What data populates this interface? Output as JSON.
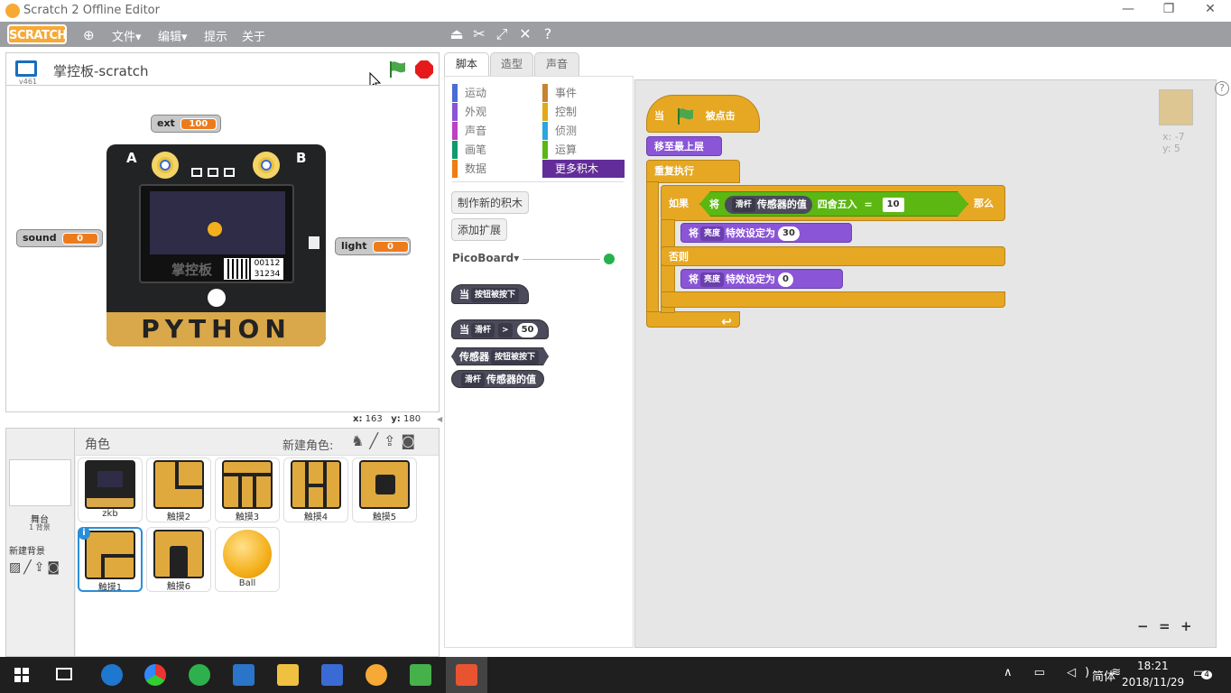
{
  "window": {
    "title": "Scratch 2 Offline Editor",
    "minimize": "—",
    "restore": "❐",
    "close": "✕"
  },
  "menu": {
    "logo": "SCRATCH",
    "file": "文件▾",
    "edit": "编辑▾",
    "tips": "提示",
    "about": "关于",
    "globe_icon": "globe-icon",
    "tools": [
      "stamp-icon",
      "cut-icon",
      "grow-icon",
      "shrink-icon",
      "help-icon"
    ]
  },
  "stage": {
    "title": "掌控板-scratch",
    "version": "v461",
    "coords": {
      "x_label": "x:",
      "x": "163",
      "y_label": "y:",
      "y": "180"
    },
    "monitors": {
      "ext": {
        "label": "ext",
        "value": "100"
      },
      "sound": {
        "label": "sound",
        "value": "0"
      },
      "light": {
        "label": "light",
        "value": "0"
      }
    },
    "board": {
      "a": "A",
      "b": "B",
      "logo_text": "掌控板",
      "code1": "00112",
      "code2": "31234",
      "python": "PYTHON"
    }
  },
  "sprites": {
    "header": "角色",
    "new_sprite": "新建角色:",
    "stage_label": "舞台",
    "stage_count": "1 背景",
    "new_backdrop": "新建背景",
    "items": [
      {
        "name": "zkb"
      },
      {
        "name": "触摸2"
      },
      {
        "name": "触摸3"
      },
      {
        "name": "触摸4"
      },
      {
        "name": "触摸5"
      },
      {
        "name": "触摸1"
      },
      {
        "name": "触摸6"
      },
      {
        "name": "Ball"
      }
    ]
  },
  "tabs": {
    "scripts": "脚本",
    "costumes": "造型",
    "sounds": "声音"
  },
  "palette": {
    "categories": [
      {
        "label": "运动",
        "color": "#4a6cd4"
      },
      {
        "label": "事件",
        "color": "#c88330"
      },
      {
        "label": "外观",
        "color": "#8a55d7"
      },
      {
        "label": "控制",
        "color": "#e1a91a"
      },
      {
        "label": "声音",
        "color": "#bb42c3"
      },
      {
        "label": "侦测",
        "color": "#2ca5e2"
      },
      {
        "label": "画笔",
        "color": "#0e9a6c"
      },
      {
        "label": "运算",
        "color": "#5cb712"
      },
      {
        "label": "数据",
        "color": "#ee7d16"
      },
      {
        "label": "更多积木",
        "color": "#632d99"
      }
    ],
    "make_block": "制作新的积木",
    "add_ext": "添加扩展",
    "ext_name": "PicoBoard▾",
    "blocks": {
      "b1": {
        "when": "当",
        "dd": "按钮被按下"
      },
      "b2": {
        "when": "当",
        "dd": "滑杆",
        "op": ">",
        "val": "50"
      },
      "b3": {
        "label": "传感器",
        "dd": "按钮被按下"
      },
      "b4": {
        "dd": "滑杆",
        "label": "传感器的值"
      }
    }
  },
  "script": {
    "hat_when": "当",
    "hat_clicked": "被点击",
    "front": "移至最上层",
    "forever": "重复执行",
    "if_label": "如果",
    "round_verb": "将",
    "slider": "滑杆",
    "sensor_value": "传感器的值",
    "round": "四舍五入",
    "eq": "=",
    "cmp_val": "10",
    "then": "那么",
    "set1": {
      "verb": "将",
      "effect": "亮度",
      "label": "特效设定为",
      "val": "30"
    },
    "else": "否则",
    "set2": {
      "verb": "将",
      "effect": "亮度",
      "label": "特效设定为",
      "val": "0"
    },
    "loop_arrow": "↩",
    "sprite_info": {
      "x": "x: -7",
      "y": "y: 5"
    },
    "zoom": {
      "out": "−",
      "reset": "=",
      "in": "+"
    }
  },
  "taskbar": {
    "time": "18:21",
    "date": "2018/11/29",
    "ime": "简体",
    "notif": "4"
  }
}
